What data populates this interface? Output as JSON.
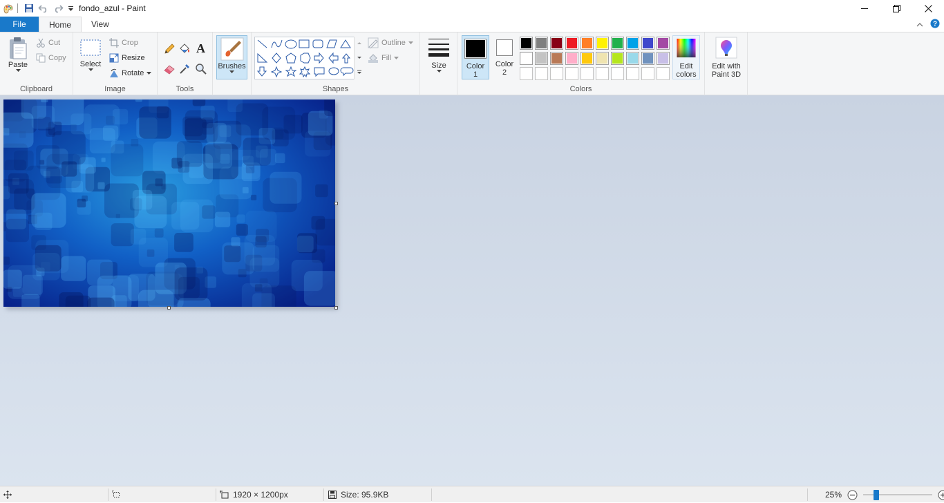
{
  "window": {
    "title": "fondo_azul - Paint"
  },
  "tabs": [
    {
      "label": "File"
    },
    {
      "label": "Home"
    },
    {
      "label": "View"
    }
  ],
  "clipboard": {
    "paste": "Paste",
    "cut": "Cut",
    "copy": "Copy",
    "group": "Clipboard"
  },
  "image_group": {
    "select": "Select",
    "crop": "Crop",
    "resize": "Resize",
    "rotate": "Rotate",
    "group": "Image"
  },
  "tools": {
    "group": "Tools"
  },
  "brushes": {
    "label": "Brushes"
  },
  "shapes": {
    "outline": "Outline",
    "fill": "Fill",
    "group": "Shapes"
  },
  "size": {
    "label": "Size"
  },
  "colors": {
    "color1_a": "Color",
    "color1_b": "1",
    "color2_a": "Color",
    "color2_b": "2",
    "edit_a": "Edit",
    "edit_b": "colors",
    "group": "Colors",
    "color1": "#000000",
    "color2": "#ffffff",
    "row1": [
      "#000000",
      "#7f7f7f",
      "#880015",
      "#ed1c24",
      "#ff7f27",
      "#fff200",
      "#22b14c",
      "#00a2e8",
      "#3f48cc",
      "#a349a4"
    ],
    "row2": [
      "#ffffff",
      "#c3c3c3",
      "#b97a57",
      "#ffaec9",
      "#ffc90e",
      "#efe4b0",
      "#b5e61d",
      "#99d9ea",
      "#7092be",
      "#c8bfe7"
    ]
  },
  "paint3d": {
    "line1": "Edit with",
    "line2": "Paint 3D"
  },
  "status": {
    "dimensions": "1920 × 1200px",
    "size": "Size: 95.9KB",
    "zoom": "25%",
    "zoom_level": 0.25
  }
}
